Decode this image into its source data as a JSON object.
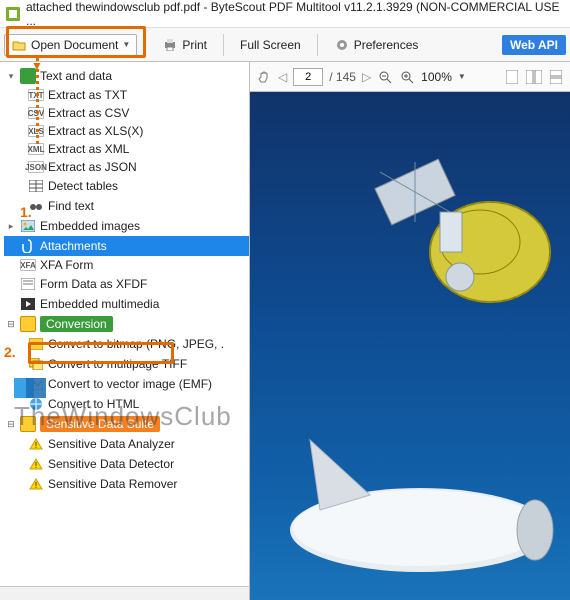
{
  "window": {
    "title": "attached thewindowsclub pdf.pdf - ByteScout PDF Multitool v11.2.1.3929 (NON-COMMERCIAL USE ..."
  },
  "toolbar": {
    "open_document": "Open Document",
    "print": "Print",
    "full_screen": "Full Screen",
    "preferences": "Preferences",
    "web_api": "Web API"
  },
  "viewer": {
    "page_current": "2",
    "page_total": "/ 145",
    "zoom": "100%"
  },
  "tree": {
    "text_and_data": {
      "label": "Text and data",
      "items": {
        "txt": "Extract as TXT",
        "csv": "Extract as CSV",
        "xls": "Extract as XLS(X)",
        "xml": "Extract as XML",
        "json": "Extract as JSON",
        "detect_tables": "Detect tables",
        "find_text": "Find text"
      }
    },
    "embedded_images": "Embedded images",
    "attachments": "Attachments",
    "xfa_form": "XFA Form",
    "form_data_xfdf": "Form Data as XFDF",
    "embedded_multimedia": "Embedded multimedia",
    "conversion": {
      "label": "Conversion",
      "items": {
        "bitmap": "Convert to bitmap (PNG, JPEG, .",
        "tiff": "Convert to multipage TIFF",
        "emf": "Convert to vector image (EMF)",
        "html": "Convert to HTML"
      }
    },
    "sensitive": {
      "label": "Sensitive Data Suite",
      "items": {
        "analyzer": "Sensitive Data Analyzer",
        "detector": "Sensitive Data Detector",
        "remover": "Sensitive Data Remover"
      }
    }
  },
  "annotations": {
    "step1": "1.",
    "step2": "2.",
    "watermark": "TheWindowsClub"
  }
}
